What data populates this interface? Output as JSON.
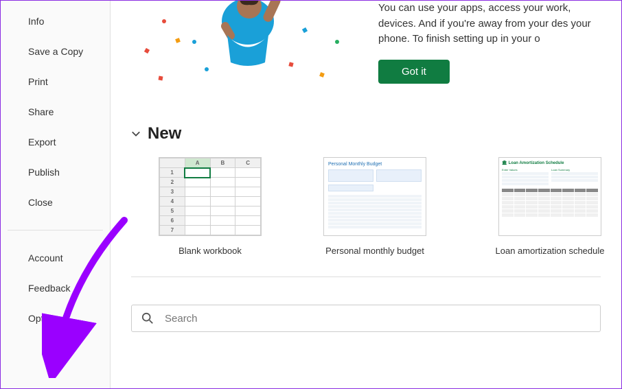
{
  "sidebar": {
    "items": [
      {
        "label": "Info"
      },
      {
        "label": "Save a Copy"
      },
      {
        "label": "Print"
      },
      {
        "label": "Share"
      },
      {
        "label": "Export"
      },
      {
        "label": "Publish"
      },
      {
        "label": "Close"
      }
    ],
    "bottom_items": [
      {
        "label": "Account"
      },
      {
        "label": "Feedback"
      },
      {
        "label": "Options"
      }
    ]
  },
  "banner": {
    "text": "You can use your apps, access your work, devices. And if you're away from your des your phone. To finish setting up in your o",
    "button": "Got it"
  },
  "new_section": {
    "title": "New",
    "templates": [
      {
        "label": "Blank workbook",
        "preview_title": ""
      },
      {
        "label": "Personal monthly budget",
        "preview_title": "Personal Monthly Budget"
      },
      {
        "label": "Loan amortization schedule",
        "preview_title": "Loan Amortization Schedule"
      }
    ]
  },
  "search": {
    "placeholder": "Search"
  },
  "colors": {
    "accent_green": "#107c41",
    "annotation_purple": "#9a00ff"
  }
}
